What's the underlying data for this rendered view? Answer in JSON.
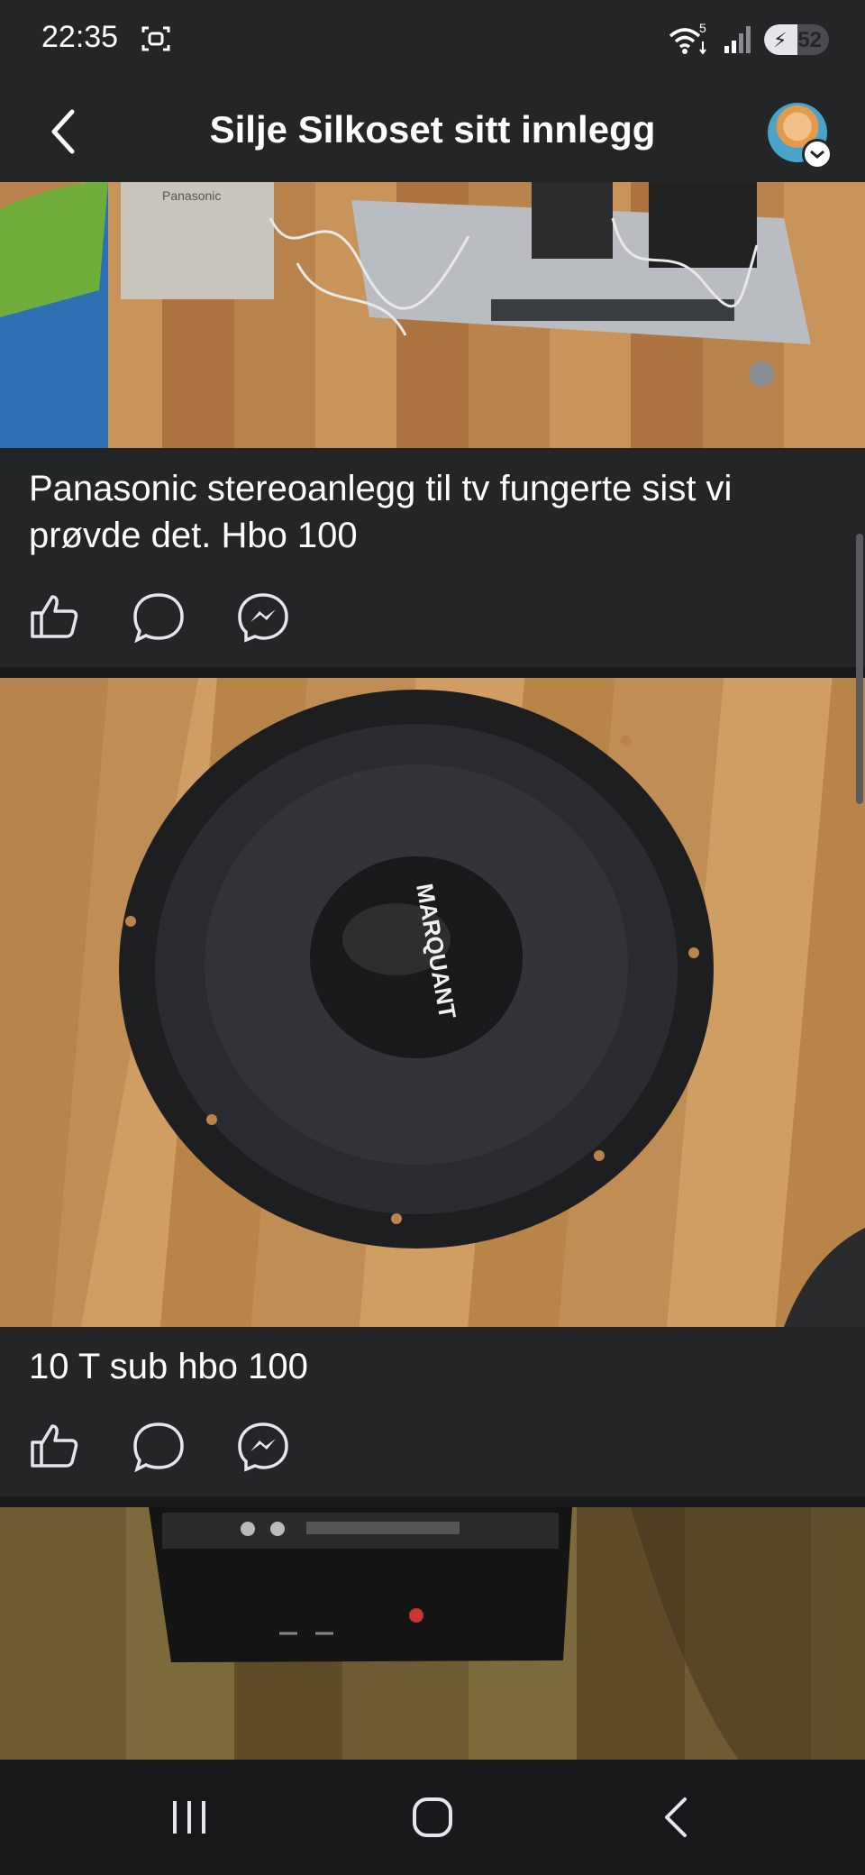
{
  "status_bar": {
    "time": "22:35",
    "screenshot_icon": "screenshot-icon",
    "wifi_icon": "wifi-icon",
    "wifi_badge": "5",
    "signal_icon": "signal-icon",
    "battery_level": "52",
    "battery_fraction": 0.52
  },
  "header": {
    "back_icon": "back-arrow-icon",
    "title": "Silje Silkoset sitt innlegg",
    "avatar": "profile-avatar",
    "avatar_badge_icon": "chevron-down-icon"
  },
  "posts": [
    {
      "image": "panasonic-stereo-photo",
      "image_text": "Panasonic",
      "caption": "Panasonic stereoanlegg til tv fungerte sist vi prøvde det. Hbo 100"
    },
    {
      "image": "subwoofer-photo",
      "image_text": "MARQUANT",
      "caption": "10 T sub hbo 100"
    },
    {
      "image": "amplifier-photo"
    }
  ],
  "actions": {
    "like_icon": "like-icon",
    "comment_icon": "comment-icon",
    "share_icon": "messenger-icon"
  },
  "nav": {
    "recents_icon": "recents-icon",
    "home_icon": "home-icon",
    "back_icon": "back-icon"
  },
  "colors": {
    "background": "#242526",
    "divider": "#18191a",
    "text": "#ffffff"
  }
}
